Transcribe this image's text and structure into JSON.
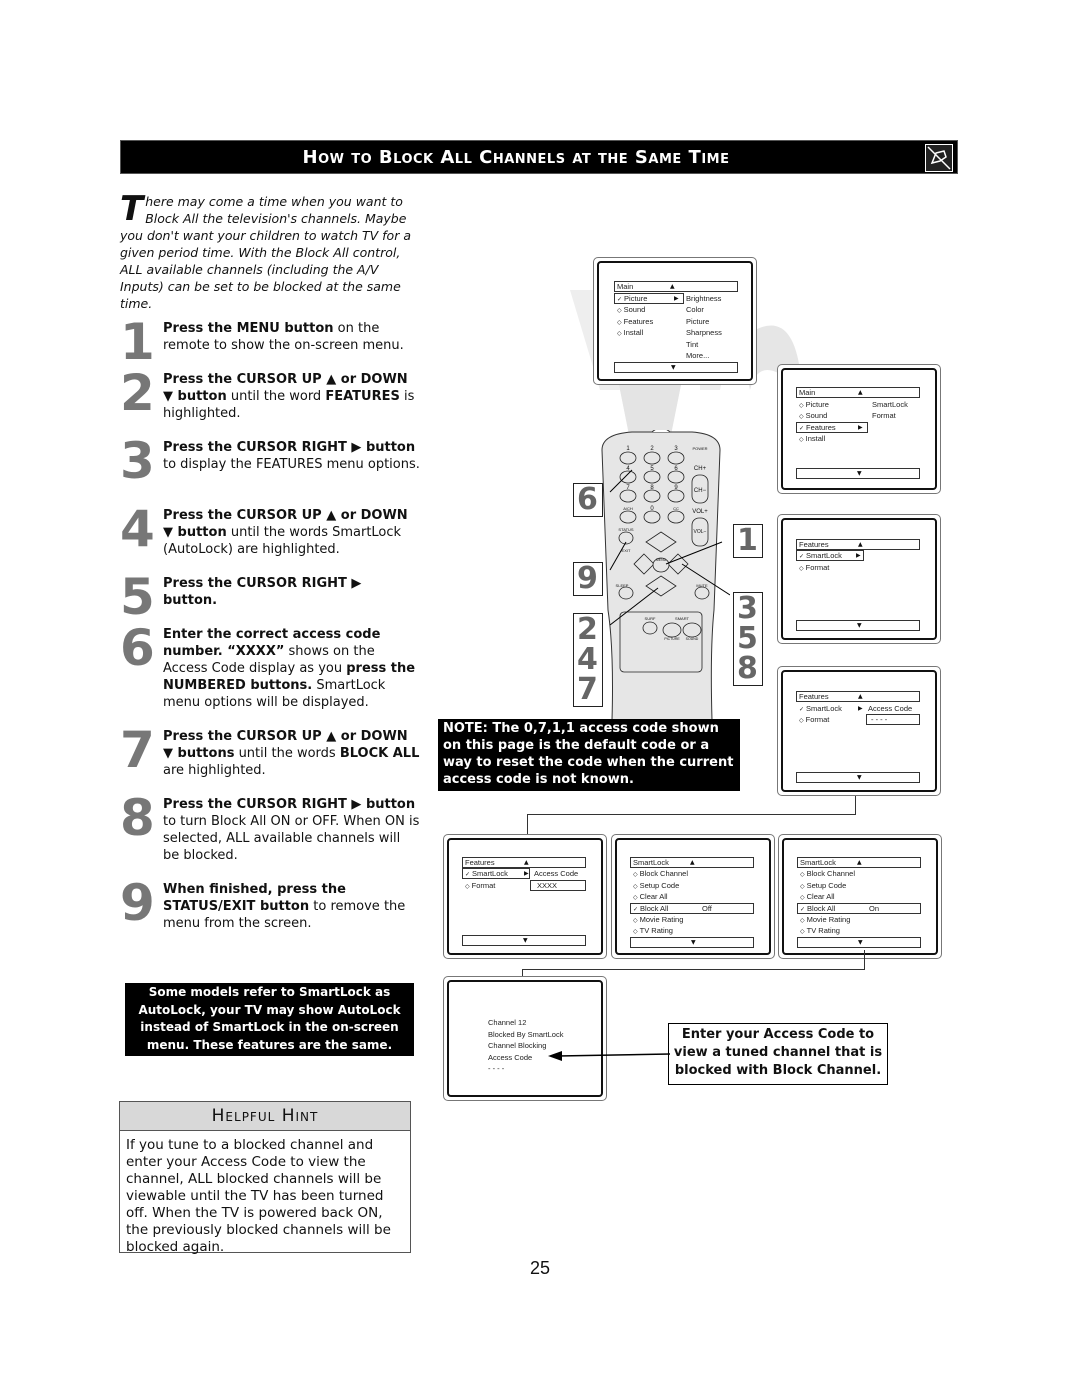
{
  "header": {
    "title": "How to Block All Channels at the Same Time",
    "icon": "hand-pointing-icon"
  },
  "intro": {
    "dropcap": "T",
    "text": "here may come a time when you want to Block All the television's channels. Maybe you don't want your children to watch TV for a given period time. With the Block All control, ALL available channels (including the A/V Inputs) can be set to be blocked at the same time."
  },
  "steps": [
    {
      "num": "1",
      "bold": "Press the MENU button",
      "rest": " on the remote to show the on-screen menu."
    },
    {
      "num": "2",
      "bold": "Press the CURSOR UP ▲ or DOWN ▼ button",
      "rest": " until the word ",
      "bold2": "FEATURES",
      "rest2": " is highlighted."
    },
    {
      "num": "3",
      "bold": "Press the CURSOR RIGHT ▶ button",
      "rest": " to display the FEATURES menu options."
    },
    {
      "num": "4",
      "bold": "Press the CURSOR UP ▲ or DOWN ▼ button",
      "rest": " until the words SmartLock (AutoLock) are highlighted."
    },
    {
      "num": "5",
      "bold": "Press the CURSOR RIGHT ▶ button.",
      "rest": ""
    },
    {
      "num": "6",
      "bold": "Enter the correct access code number. “XXXX”",
      "rest": " shows on the Access Code display as you ",
      "bold2": "press the NUMBERED buttons.",
      "rest2": " SmartLock menu options will be displayed."
    },
    {
      "num": "7",
      "bold": "Press the CURSOR UP ▲ or DOWN ▼ buttons",
      "rest": " until the words ",
      "bold2": "BLOCK ALL",
      "rest2": " are highlighted."
    },
    {
      "num": "8",
      "bold": "Press the CURSOR RIGHT ▶ button",
      "rest": " to turn Block All ON or OFF. When ON is selected, ALL available channels will be blocked."
    },
    {
      "num": "9",
      "bold": "When finished, press the STATUS/EXIT button",
      "rest": " to remove the menu from the screen."
    }
  ],
  "smartlock_note": "Some models refer to SmartLock as AutoLock, your TV may show AutoLock instead of SmartLock in the on-screen menu. These features are the same.",
  "hint": {
    "title": "Helpful Hint",
    "body": "If you tune to a blocked channel and enter your Access Code to view the channel, ALL blocked channels will be viewable until the TV has been turned off. When the TV is powered back ON, the previously blocked channels will be blocked again."
  },
  "access_note": "NOTE: The 0,7,1,1 access code shown on this page is the default code or a way to reset the code when the current access code is not known.",
  "screens": {
    "main_picture": {
      "title": "Main",
      "items": [
        "Picture",
        "Sound",
        "Features",
        "Install"
      ],
      "sub": [
        "Brightness",
        "Color",
        "Picture",
        "Sharpness",
        "Tint",
        "More..."
      ]
    },
    "main_features": {
      "title": "Main",
      "items": [
        "Picture",
        "Sound",
        "Features",
        "Install"
      ],
      "sub": [
        "SmartLock",
        "Format"
      ]
    },
    "features_smartlock": {
      "title": "Features",
      "items": [
        "SmartLock",
        "Format"
      ]
    },
    "features_access": {
      "title": "Features",
      "items": [
        "SmartLock",
        "Format"
      ],
      "sub_label": "Access Code",
      "code": "- - - -"
    },
    "features_xxxx": {
      "title": "Features",
      "items": [
        "SmartLock",
        "Format"
      ],
      "sub_label": "Access Code",
      "code": "XXXX"
    },
    "smartlock_off": {
      "title": "SmartLock",
      "items": [
        "Block Channel",
        "Setup Code",
        "Clear All",
        "Block All",
        "Movie Rating",
        "TV Rating"
      ],
      "value": "Off"
    },
    "smartlock_on": {
      "title": "SmartLock",
      "items": [
        "Block Channel",
        "Setup Code",
        "Clear All",
        "Block All",
        "Movie Rating",
        "TV Rating"
      ],
      "value": "On"
    },
    "blocked": {
      "lines": [
        "Channel 12",
        "Blocked By SmartLock",
        "Channel Blocking",
        "Access Code",
        "- - - -"
      ]
    }
  },
  "remote": {
    "keys": [
      "1",
      "2",
      "3",
      "POWER",
      "4",
      "5",
      "6",
      "CH+",
      "7",
      "8",
      "9",
      "CH−",
      "A/CH",
      "0",
      "CC",
      "VOL+",
      "STATUS",
      "VOL−",
      "EXIT",
      "MENU",
      "SLEEP",
      "MUTE",
      "SURF",
      "SMART",
      "PICTURE",
      "SOUND"
    ],
    "callouts_left": [
      "6",
      "9",
      "2",
      "4",
      "7"
    ],
    "callouts_right": [
      "1",
      "3",
      "5",
      "8"
    ]
  },
  "enter_note": "Enter your Access Code to view a tuned channel that is blocked with Block Channel.",
  "page_number": "25"
}
